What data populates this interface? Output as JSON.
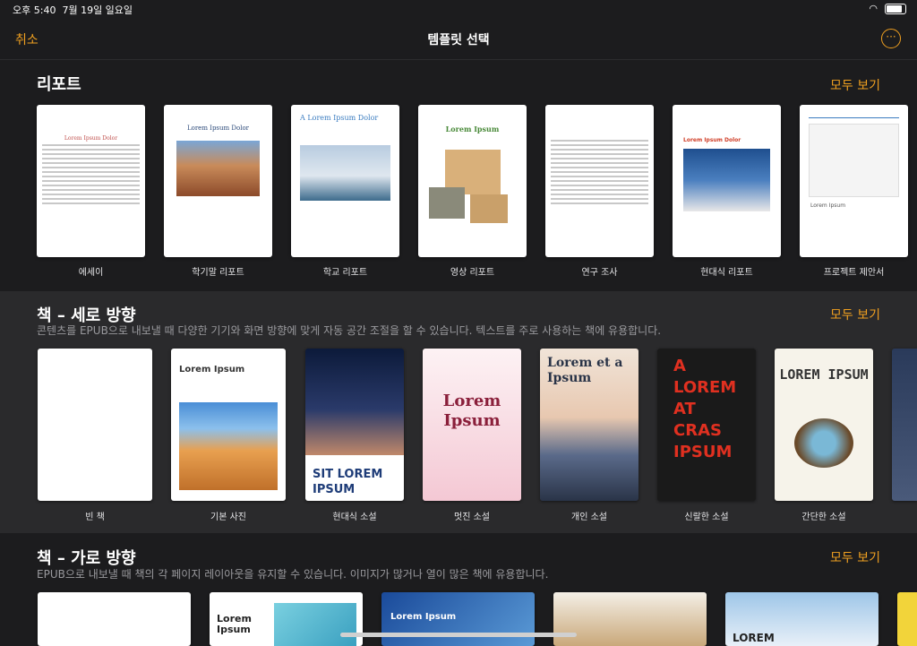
{
  "status": {
    "time": "오후 5:40",
    "date": "7월 19일 일요일"
  },
  "nav": {
    "cancel": "취소",
    "title": "템플릿 선택",
    "more_icon": "ellipsis-circle-icon"
  },
  "reports": {
    "title": "리포트",
    "see_all": "모두 보기",
    "items": [
      {
        "label": "에세이",
        "thumb_title": "Lorem Ipsum Dolor"
      },
      {
        "label": "학기말 리포트",
        "thumb_title": "Lorem Ipsum Dolor"
      },
      {
        "label": "학교 리포트",
        "thumb_title": "A Lorem Ipsum Dolor"
      },
      {
        "label": "영상 리포트",
        "thumb_title": "Lorem Ipsum"
      },
      {
        "label": "연구 조사",
        "thumb_title": ""
      },
      {
        "label": "현대식 리포트",
        "thumb_title": "Lorem Ipsum Dolor"
      },
      {
        "label": "프로젝트 제안서",
        "thumb_title": "Lorem Ipsum"
      }
    ]
  },
  "portrait": {
    "title": "책 – 세로 방향",
    "subtitle": "콘텐츠를 EPUB으로 내보낼 때 다양한 기기와 화면 방향에 맞게 자동 공간 조절을 할 수 있습니다. 텍스트를 주로 사용하는 책에 유용합니다.",
    "see_all": "모두 보기",
    "items": [
      {
        "label": "빈 책",
        "thumb_title": ""
      },
      {
        "label": "기본 사진",
        "thumb_title": "Lorem Ipsum"
      },
      {
        "label": "현대식 소설",
        "thumb_title": "SIT LOREM IPSUM"
      },
      {
        "label": "멋진 소설",
        "thumb_title": "Lorem Ipsum"
      },
      {
        "label": "개인 소설",
        "thumb_title": "Lorem et a Ipsum"
      },
      {
        "label": "신랄한 소설",
        "thumb_title": "A LOREM AT CRAS IPSUM"
      },
      {
        "label": "간단한 소설",
        "thumb_title": "LOREM IPSUM"
      }
    ]
  },
  "landscape": {
    "title": "책 – 가로 방향",
    "subtitle": "EPUB으로 내보낼 때 책의 각 페이지 레이아웃을 유지할 수 있습니다. 이미지가 많거나 열이 많은 책에 유용합니다.",
    "see_all": "모두 보기",
    "items": [
      {
        "thumb_title": ""
      },
      {
        "thumb_title": "Lorem Ipsum"
      },
      {
        "thumb_title": "Lorem Ipsum"
      },
      {
        "thumb_title": ""
      },
      {
        "thumb_title": "LOREM"
      }
    ]
  }
}
